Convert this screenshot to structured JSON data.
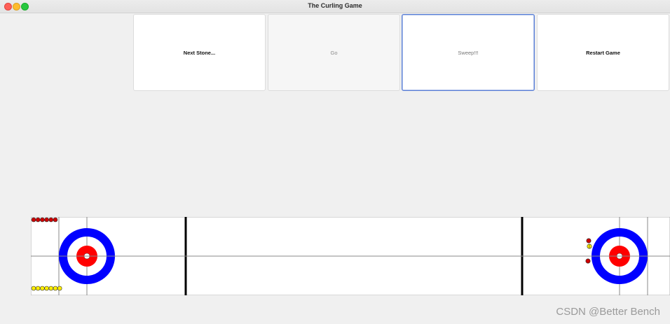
{
  "window": {
    "title": "The Curling Game"
  },
  "toolbar": {
    "next_stone_label": "Next Stone...",
    "go_label": "Go",
    "sweep_label": "Sweep!!!",
    "restart_label": "Restart Game"
  },
  "watermark": "CSDN @Better Bench",
  "colors": {
    "house_outer": "#0000ff",
    "house_inner": "#ff0000",
    "stone_red": "#cc0000",
    "stone_yellow": "#ffee00",
    "sheet": "#ffffff"
  },
  "game": {
    "red_stones_remaining": 6,
    "yellow_stones_remaining": 7
  }
}
